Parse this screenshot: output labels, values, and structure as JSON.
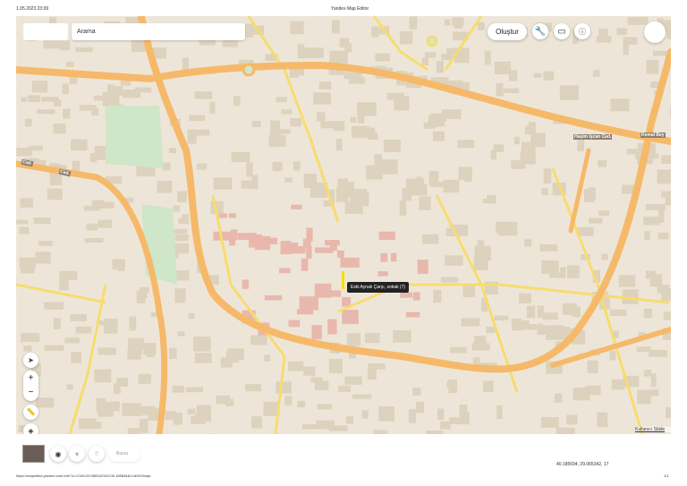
{
  "print_header": {
    "datetime": "1.05.2023 23:09",
    "title": "Yandex Map Editor"
  },
  "toolbar": {
    "search_placeholder": "Arama",
    "create_label": "Oluştur",
    "icons": [
      "wrench-icon",
      "feedback-icon",
      "info-icon"
    ]
  },
  "map": {
    "tooltip": "Eski Aynalı Çarşı, sokak (7)",
    "road_labels": [
      "Haşim İşcan Cad.",
      "Kemal Bey",
      "Cad.",
      "Cad."
    ],
    "terms_link": "Kullanıcı Sözle",
    "controls": [
      "compass-icon",
      "zoom-in",
      "zoom-out",
      "ruler-icon",
      "layers-icon"
    ]
  },
  "bottom_bar": {
    "city": "Bursa",
    "coordinates": "40.185694, 29.065342, 17"
  },
  "print_footer": {
    "url": "https://mapeditor.yandex.com.tr/#!?z=17&ll=29.065342%2C40.185694&l=nk%23map",
    "page": "1/1"
  },
  "colors": {
    "land": "#ede6d8",
    "building": "#ddd2bd",
    "major_road": "#f6b96a",
    "minor_road": "#f7dc6f",
    "highlight_building": "#e8b8ad",
    "park": "#cfe6c8"
  }
}
